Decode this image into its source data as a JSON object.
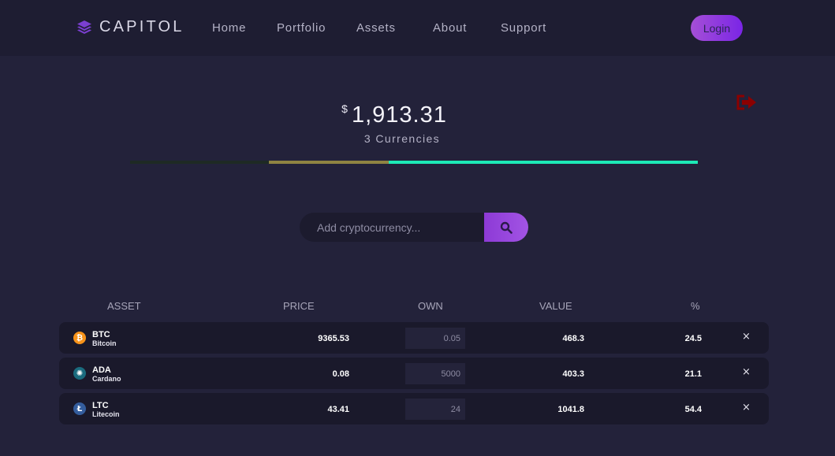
{
  "brand": {
    "name": "CAPITOL",
    "icon": "layers-icon"
  },
  "nav": {
    "links": [
      "Home",
      "Portfolio",
      "Assets",
      "About",
      "Support"
    ],
    "login_label": "Login"
  },
  "summary": {
    "currency_symbol": "$",
    "total": "1,913.31",
    "subtitle": "3 Currencies"
  },
  "allocation_bar": [
    {
      "asset": "BTC",
      "percent": 24.5,
      "color": "#1e2a24"
    },
    {
      "asset": "ADA",
      "percent": 21.1,
      "color": "#8f8442"
    },
    {
      "asset": "LTC",
      "percent": 54.4,
      "color": "#1de9b6"
    }
  ],
  "search": {
    "placeholder": "Add cryptocurrency...",
    "icon": "search-icon"
  },
  "table": {
    "headers": [
      "ASSET",
      "PRICE",
      "OWN",
      "VALUE",
      "%"
    ],
    "rows": [
      {
        "symbol": "BTC",
        "name": "Bitcoin",
        "price": "9365.53",
        "own": "0.05",
        "value": "468.3",
        "percent": "24.5",
        "remove": "×",
        "icon_color": "#f7931a",
        "icon_glyph": "₿"
      },
      {
        "symbol": "ADA",
        "name": "Cardano",
        "price": "0.08",
        "own": "5000",
        "value": "403.3",
        "percent": "21.1",
        "remove": "×",
        "icon_color": "#1a6b7e",
        "icon_glyph": "✺"
      },
      {
        "symbol": "LTC",
        "name": "Litecoin",
        "price": "43.41",
        "own": "24",
        "value": "1041.8",
        "percent": "54.4",
        "remove": "×",
        "icon_color": "#345d9d",
        "icon_glyph": "Ł"
      }
    ]
  },
  "colors": {
    "accent": "#8d3ad6",
    "logout": "#8b0000"
  }
}
